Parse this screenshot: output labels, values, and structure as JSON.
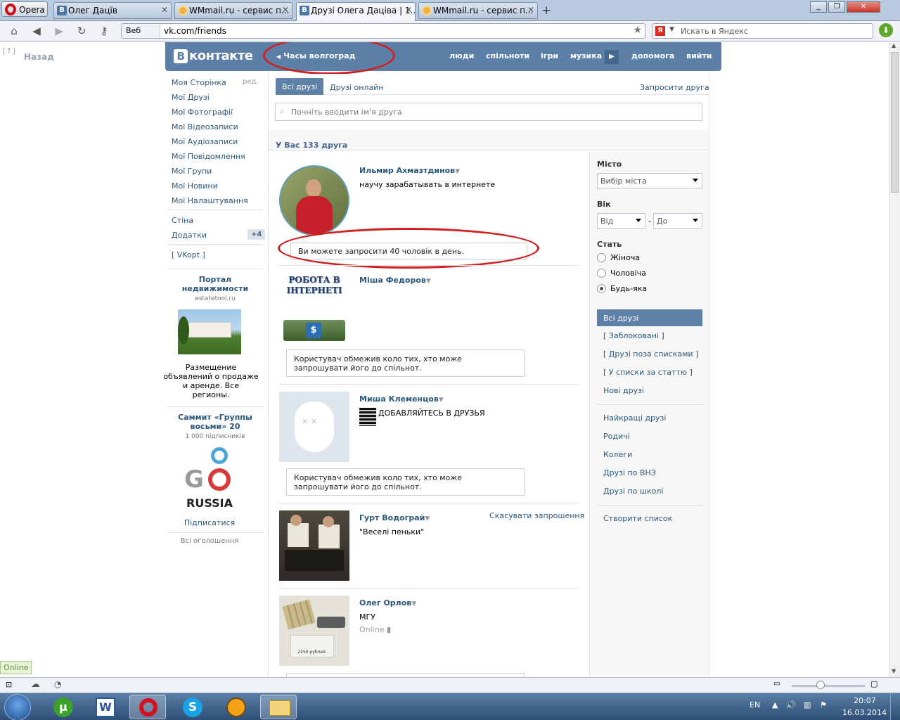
{
  "browser": {
    "menu_label": "Opera",
    "tabs": [
      {
        "label": "Олег Дацїв",
        "icon": "vk-icon"
      },
      {
        "label": "WMmail.ru - сервис п...",
        "icon": "wmmail-icon"
      },
      {
        "label": "Друзі Олега Даціва | 1...",
        "icon": "vk-icon",
        "active": true
      },
      {
        "label": "WMmail.ru - сервис п...",
        "icon": "wmmail-icon"
      }
    ],
    "address_prefix": "Веб",
    "url": "vk.com/friends",
    "search_placeholder": "Искать в Яндекс"
  },
  "page": {
    "back_label": "Назад",
    "vk_logo": "контакте",
    "vk_logo_letter": "В",
    "status_text": "Часы волгоград",
    "nav": [
      "люди",
      "спільноти",
      "ігри",
      "музика",
      "допомога",
      "вийти"
    ],
    "left_menu": {
      "edit_label": "ред.",
      "items": [
        "Моя Сторінка",
        "Мої Друзі",
        "Мої Фотографії",
        "Мої Відеозаписи",
        "Мої Аудіозаписи",
        "Мої Повідомлення",
        "Мої Групи",
        "Мої Новини",
        "Мої Налаштування"
      ],
      "wall": "Стіна",
      "apps": "Додатки",
      "apps_badge": "+4",
      "vkopt": "[ VKopt ]"
    },
    "ads": {
      "ad1_title": "Портал недвижимости",
      "ad1_site": "estatetool.ru",
      "ad1_text": "Размещение объявлений о продаже и аренде. Все регионы.",
      "ad2_title": "Саммит «Группы восьми» 20",
      "ad2_subscribers": "1 000 підписників",
      "ad2_logo": "RUSSIA",
      "ad2_logo_go": "G",
      "subscribe": "Підписатися",
      "all_ads": "Всі оголошення"
    },
    "tabs": {
      "all": "Всі друзі",
      "online": "Друзі онлайн",
      "invite": "Запросити друга"
    },
    "search_placeholder": "Почніть вводити ім'я друга",
    "friends_count": "У Вас 133 друга",
    "friends": [
      {
        "name": "Ильмир Ахмазтдинов",
        "status": "научу зарабатывать в интернете",
        "notice": "Ви можете запросити 40 чоловік в день."
      },
      {
        "name": "Міша Федоров",
        "avatar_text": "РОБОТА В ІНТЕРНЕТІ",
        "avatar_symbol": "$",
        "notice": "Користувач обмежив коло тих, хто може запрошувати його до спільнот."
      },
      {
        "name": "Миша Клеменцов",
        "status": "ДОБАВЛЯЙТЕСЬ В ДРУЗЬЯ",
        "notice": "Користувач обмежив коло тих, хто може запрошувати його до спільнот."
      },
      {
        "name": "Гурт Водограй",
        "status": "\"Веселі пеньки\"",
        "action": "Скасувати запрошення"
      },
      {
        "name": "Олег Орлов",
        "status": "МГУ",
        "online": "Online",
        "avatar_caption": "2250 рублей."
      }
    ],
    "filters": {
      "city_label": "Місто",
      "city_value": "Вибір міста",
      "age_label": "Вік",
      "age_from": "Від",
      "age_dash": "-",
      "age_to": "До",
      "sex_label": "Стать",
      "sex_options": [
        "Жіноча",
        "Чоловіча",
        "Будь-яка"
      ],
      "sex_selected": "Будь-яка"
    },
    "lists": [
      "Всі друзі",
      "[ Заблоковані ]",
      "[ Друзі поза списками ]",
      "[ У списки за статтю ]",
      "Нові друзі",
      "Найкращі друзі",
      "Родичі",
      "Колеги",
      "Друзі по ВНЗ",
      "Друзі по школі",
      "Створити список"
    ]
  },
  "statusbar": {
    "online": "Online"
  },
  "taskbar": {
    "lang": "EN",
    "time": "20:07",
    "date": "16.03.2014"
  },
  "colors": {
    "vk_blue": "#5b7fa6",
    "link": "#2b587a",
    "highlight_circle": "#d12020"
  }
}
